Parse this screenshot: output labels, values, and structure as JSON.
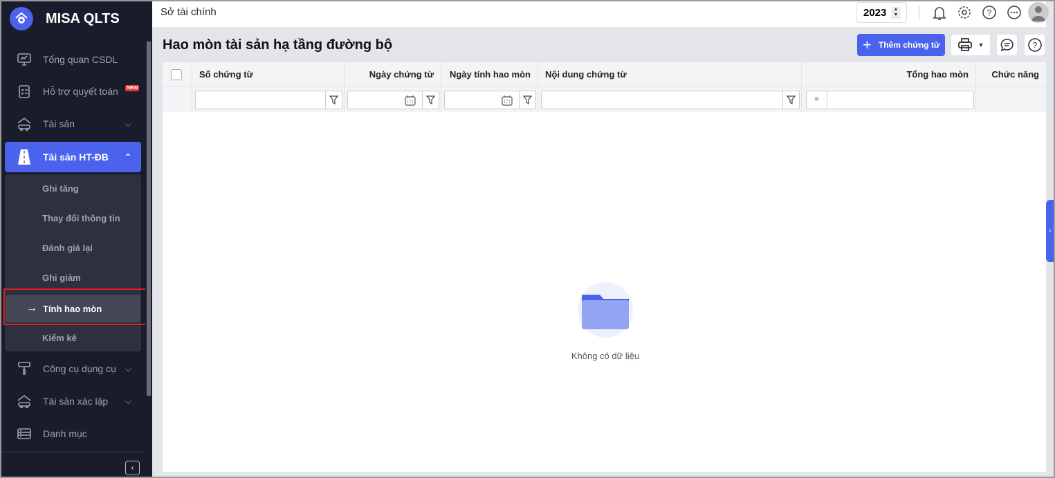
{
  "app": {
    "name": "MISA QLTS"
  },
  "sidebar": {
    "items": [
      {
        "label": "Tổng quan CSDL",
        "icon": "monitor-chart-icon"
      },
      {
        "label": "Hỗ trợ quyết toán",
        "icon": "clipboard-check-icon",
        "badge": "NEW"
      },
      {
        "label": "Tài sản",
        "icon": "house-car-icon"
      },
      {
        "label": "Tài sản HT-ĐB",
        "icon": "road-icon"
      },
      {
        "label": "Công cụ dụng cụ",
        "icon": "paint-roller-icon"
      },
      {
        "label": "Tài sản xác lập",
        "icon": "house-car-icon"
      },
      {
        "label": "Danh mục",
        "icon": "list-icon"
      }
    ],
    "subitems": [
      "Ghi tăng",
      "Thay đổi thông tin",
      "Đánh giá lại",
      "Ghi giảm",
      "Tính hao mòn",
      "Kiểm kê"
    ],
    "current_arrow": "→"
  },
  "topbar": {
    "breadcrumb": "Sở tài chính",
    "year": "2023"
  },
  "page": {
    "title": "Hao mòn tài sản hạ tầng đường bộ",
    "add_button": "Thêm chứng từ"
  },
  "table": {
    "columns": [
      "Số chứng từ",
      "Ngày chứng từ",
      "Ngày tính hao mòn",
      "Nội dung chứng từ",
      "Tổng hao mòn",
      "Chức năng"
    ],
    "operator": "=",
    "empty_text": "Không có dữ liệu"
  },
  "colors": {
    "accent": "#4a62ec",
    "sidebar": "#191c2b"
  }
}
